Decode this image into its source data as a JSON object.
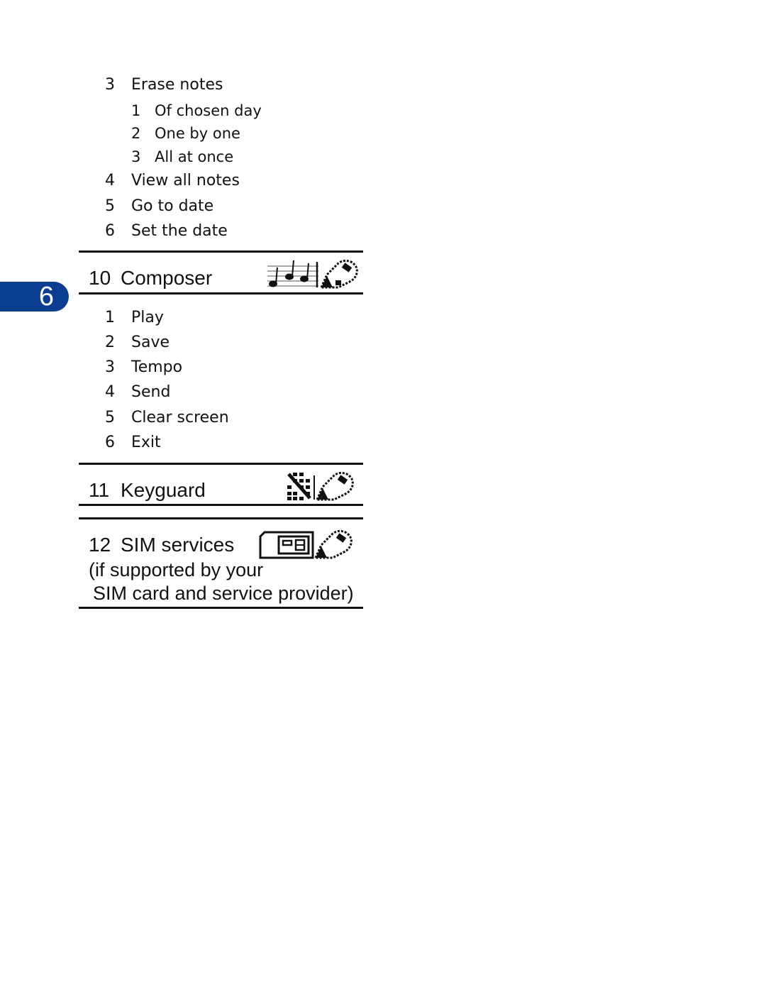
{
  "chapter_tab": {
    "number": "6",
    "color": "#0b3d91"
  },
  "calendar_items": [
    {
      "num": "3",
      "label": "Erase notes",
      "subitems": [
        {
          "num": "1",
          "label": "Of chosen day"
        },
        {
          "num": "2",
          "label": "One by one"
        },
        {
          "num": "3",
          "label": "All at once"
        }
      ]
    },
    {
      "num": "4",
      "label": "View all notes"
    },
    {
      "num": "5",
      "label": "Go to date"
    },
    {
      "num": "6",
      "label": "Set the date"
    }
  ],
  "sections": [
    {
      "num": "10",
      "title": "Composer",
      "icon": "music-notes-icon",
      "items": [
        {
          "num": "1",
          "label": "Play"
        },
        {
          "num": "2",
          "label": "Save"
        },
        {
          "num": "3",
          "label": "Tempo"
        },
        {
          "num": "4",
          "label": "Send"
        },
        {
          "num": "5",
          "label": "Clear screen"
        },
        {
          "num": "6",
          "label": "Exit"
        }
      ]
    },
    {
      "num": "11",
      "title": "Keyguard",
      "icon": "keypad-lock-icon"
    },
    {
      "num": "12",
      "title": "SIM services",
      "icon": "sim-card-icon",
      "note_line1": "(if supported by your",
      "note_line2": "SIM card and service provider)"
    }
  ]
}
